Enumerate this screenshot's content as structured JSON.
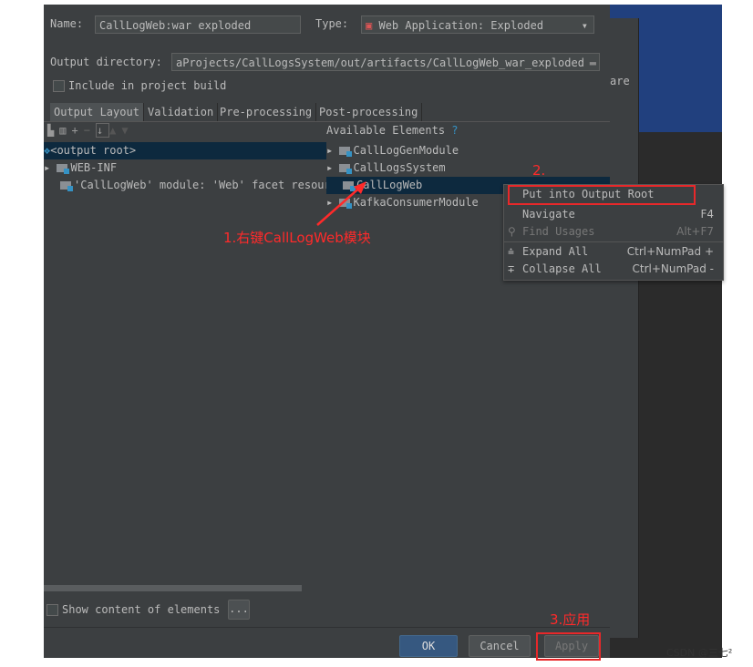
{
  "dialog": {
    "name_label": "Name:",
    "name_value": "CallLogWeb:war exploded",
    "type_label": "Type:",
    "type_value": "Web Application: Exploded",
    "output_dir_label": "Output directory:",
    "output_dir_value": "aProjects/CallLogsSystem/out/artifacts/CallLogWeb_war_exploded",
    "include_build": "Include in project build",
    "include_build_checked": false,
    "tabs": [
      "Output Layout",
      "Validation",
      "Pre-processing",
      "Post-processing"
    ],
    "active_tab": "Output Layout",
    "tree": [
      "<output root>",
      "WEB-INF",
      "'CallLogWeb' module: 'Web' facet resour"
    ],
    "available_label": "Available Elements",
    "help": "?",
    "available": [
      "CallLogGenModule",
      "CallLogsSystem",
      "CallLogWeb",
      "KafkaConsumerModule"
    ],
    "show_content": "Show content of elements",
    "more_button": "...",
    "ok": "OK",
    "cancel": "Cancel",
    "apply": "Apply"
  },
  "behind_text": "are",
  "context_menu": [
    {
      "label": "Put into Output Root",
      "shortcut": ""
    },
    {
      "label": "Navigate",
      "shortcut": "F4"
    },
    {
      "label": "Find Usages",
      "shortcut": "Alt+F7",
      "disabled": true
    },
    {
      "label": "Expand All",
      "shortcut": "Ctrl+NumPad +"
    },
    {
      "label": "Collapse All",
      "shortcut": "Ctrl+NumPad -"
    }
  ],
  "annotations": {
    "step1": "1.右键CallLogWeb模块",
    "step2": "2.",
    "step3": "3.应用",
    "color": "#ff2a2a"
  },
  "watermark": "CSDN @三七²"
}
